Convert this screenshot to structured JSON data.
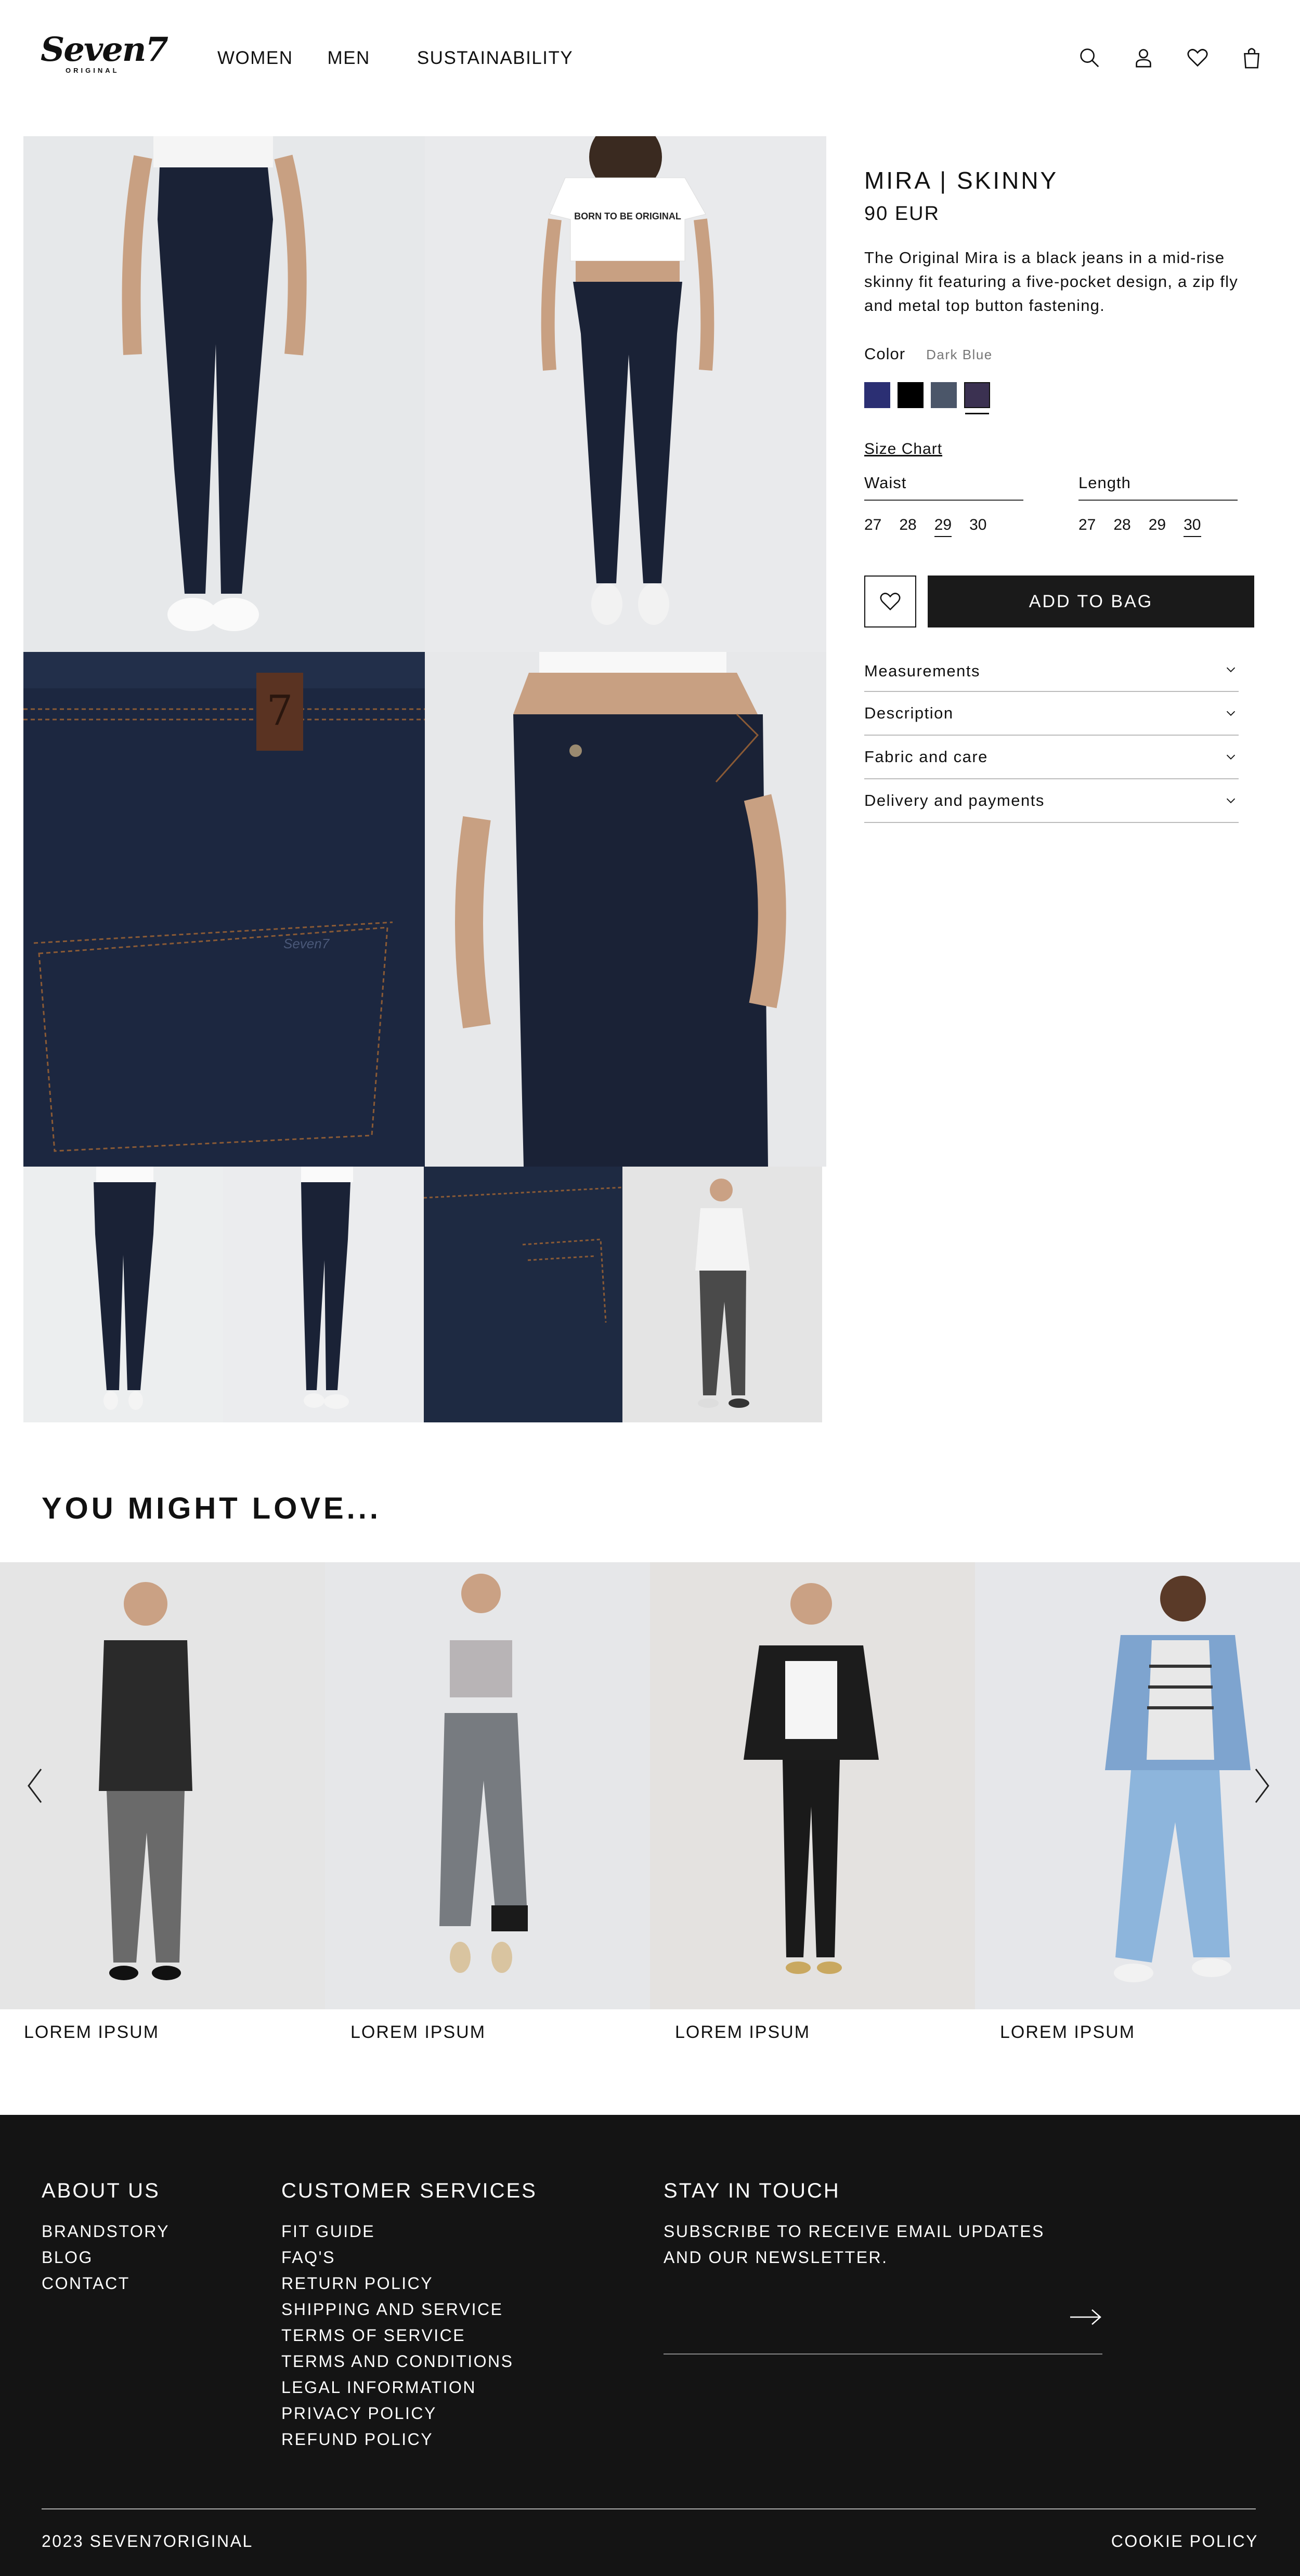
{
  "brand": {
    "logo_text": "Seven7",
    "logo_sub": "ORIGINAL"
  },
  "nav": {
    "items": [
      "WOMEN",
      "MEN",
      "SUSTAINABILITY"
    ]
  },
  "header_icons": [
    "search-icon",
    "account-icon",
    "wishlist-icon",
    "bag-icon"
  ],
  "product": {
    "title": "MIRA | SKINNY",
    "price": "90 EUR",
    "description": "The Original Mira is a black jeans in a mid-rise skinny fit featuring a five-pocket design, a zip fly and metal top button fastening.",
    "color_label": "Color",
    "color_value": "Dark Blue",
    "swatches": [
      "#2b2f73",
      "#000000",
      "#4b5669",
      "#3b3151"
    ],
    "size_chart_label": "Size Chart",
    "waist_label": "Waist",
    "waist_sizes": [
      "27",
      "28",
      "29",
      "30"
    ],
    "length_label": "Length",
    "length_sizes": [
      "27",
      "28",
      "29",
      "30"
    ],
    "add_to_bag": "ADD TO BAG",
    "accordion": [
      "Measurements",
      "Description",
      "Fabric and care",
      "Delivery and payments"
    ]
  },
  "recommendations": {
    "title": "YOU MIGHT LOVE...",
    "items": [
      "LOREM IPSUM",
      "LOREM IPSUM",
      "LOREM IPSUM",
      "LOREM IPSUM"
    ]
  },
  "footer": {
    "about_heading": "ABOUT US",
    "about_links": [
      "BRANDSTORY",
      "BLOG",
      "CONTACT"
    ],
    "services_heading": "CUSTOMER SERVICES",
    "services_links": [
      "FIT GUIDE",
      "FAQ'S",
      "RETURN POLICY",
      "SHIPPING AND SERVICE",
      "TERMS OF SERVICE",
      "TERMS AND CONDITIONS",
      "LEGAL INFORMATION",
      "PRIVACY POLICY",
      "REFUND POLICY"
    ],
    "touch_heading": "STAY IN TOUCH",
    "touch_text": "SUBSCRIBE TO RECEIVE EMAIL UPDATES AND OUR NEWSLETTER.",
    "copyright": "2023 SEVEN7ORIGINAL",
    "cookie": "COOKIE POLICY"
  }
}
